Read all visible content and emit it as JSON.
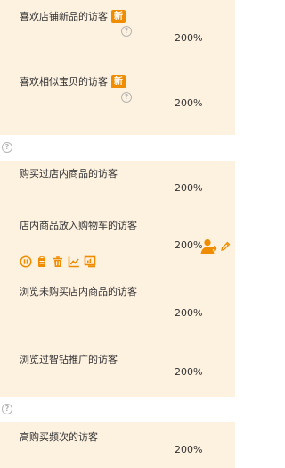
{
  "group1": {
    "rows": [
      {
        "label": "喜欢店铺新品的访客",
        "badge": "新",
        "percent": "200%"
      },
      {
        "label": "喜欢相似宝贝的访客",
        "badge": "新",
        "percent": "200%"
      }
    ]
  },
  "group2": {
    "rows": [
      {
        "label": "购买过店内商品的访客",
        "percent": "200%"
      },
      {
        "label": "店内商品放入购物车的访客",
        "percent": "200%"
      },
      {
        "label": "浏览未购买店内商品的访客",
        "percent": "200%"
      },
      {
        "label": "浏览过智钻推广的访客",
        "percent": "200%"
      }
    ]
  },
  "group3": {
    "rows": [
      {
        "label": "高购买频次的访客",
        "percent": "200%"
      }
    ]
  },
  "help_glyph": "?",
  "colors": {
    "panel_bg": "#fdf1e0",
    "accent": "#f08c00",
    "help_gray": "#b5b5b5"
  },
  "icons": {
    "row_actions": [
      "pause-icon",
      "clipboard-icon",
      "trash-icon",
      "trend-chart-icon",
      "report-icon"
    ],
    "hover_actions": [
      "assign-user-icon",
      "edit-pencil-icon"
    ]
  }
}
